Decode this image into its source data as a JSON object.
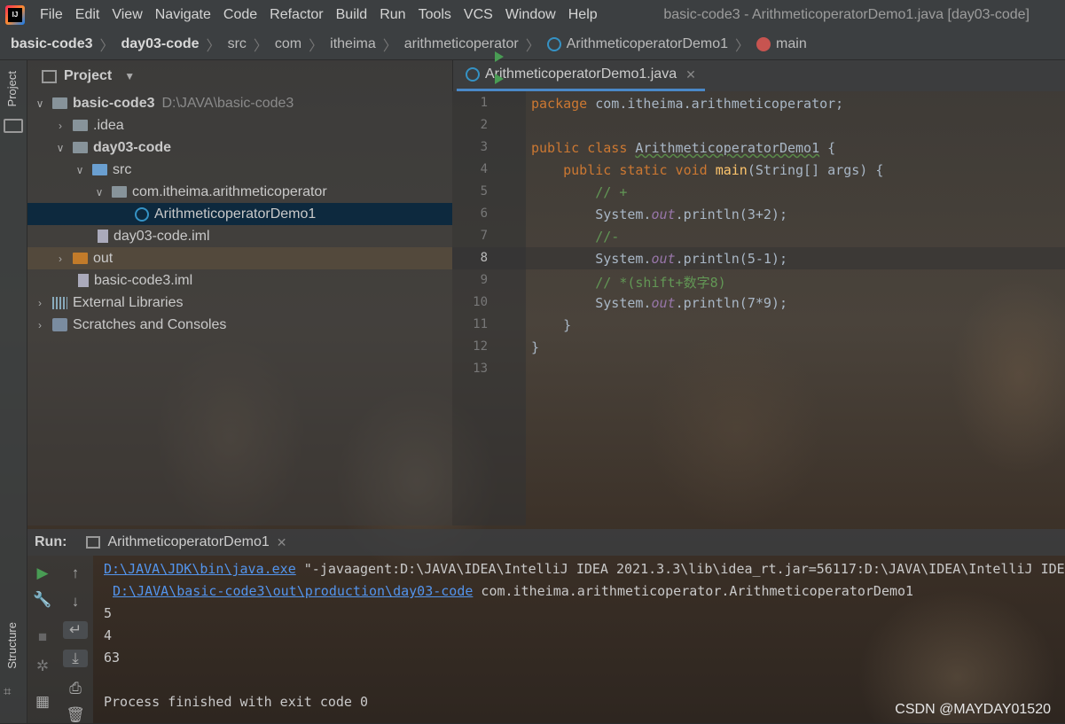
{
  "menubar": {
    "items": [
      "File",
      "Edit",
      "View",
      "Navigate",
      "Code",
      "Refactor",
      "Build",
      "Run",
      "Tools",
      "VCS",
      "Window",
      "Help"
    ],
    "title": "basic-code3 - ArithmeticoperatorDemo1.java [day03-code]"
  },
  "breadcrumb": [
    "basic-code3",
    "day03-code",
    "src",
    "com",
    "itheima",
    "arithmeticoperator",
    "ArithmeticoperatorDemo1",
    "main"
  ],
  "sidebar": {
    "project_tab": "Project",
    "structure_tab": "Structure"
  },
  "project": {
    "title": "Project",
    "root_name": "basic-code3",
    "root_path": "D:\\JAVA\\basic-code3",
    "idea": ".idea",
    "module": "day03-code",
    "src": "src",
    "package": "com.itheima.arithmeticoperator",
    "class_file": "ArithmeticoperatorDemo1",
    "module_iml": "day03-code.iml",
    "out": "out",
    "root_iml": "basic-code3.iml",
    "ext_libs": "External Libraries",
    "scratches": "Scratches and Consoles"
  },
  "editor": {
    "tab": "ArithmeticoperatorDemo1.java",
    "line_numbers": [
      "1",
      "2",
      "3",
      "4",
      "5",
      "6",
      "7",
      "8",
      "9",
      "10",
      "11",
      "12",
      "13"
    ],
    "l1a": "package",
    "l1b": " com.itheima.arithmeticoperator;",
    "l3a": "public class",
    "l3b": "ArithmeticoperatorDemo1",
    "l3c": " {",
    "l4a": "    public static void",
    "l4b": "main",
    "l4c": "(String[] args) {",
    "c5": "        // +",
    "l6a": "        System.",
    "out": "out",
    "l6b": ".println(3+2);",
    "c7": "        //-",
    "l8b": ".println(5-1);",
    "c9": "        // *(shift+数字8)",
    "l10b": ".println(7*9);",
    "l11": "    }",
    "l12": "}"
  },
  "run": {
    "label": "Run:",
    "tab": "ArithmeticoperatorDemo1",
    "line1_link": "D:\\JAVA\\JDK\\bin\\java.exe",
    "line1_rest": " \"-javaagent:D:\\JAVA\\IDEA\\IntelliJ IDEA 2021.3.3\\lib\\idea_rt.jar=56117:D:\\JAVA\\IDEA\\IntelliJ IDEA",
    "line2_link": "D:\\JAVA\\basic-code3\\out\\production\\day03-code",
    "line2_rest": " com.itheima.arithmeticoperator.ArithmeticoperatorDemo1",
    "out1": "5",
    "out2": "4",
    "out3": "63",
    "finish": "Process finished with exit code 0"
  },
  "watermark": "CSDN @MAYDAY01520"
}
